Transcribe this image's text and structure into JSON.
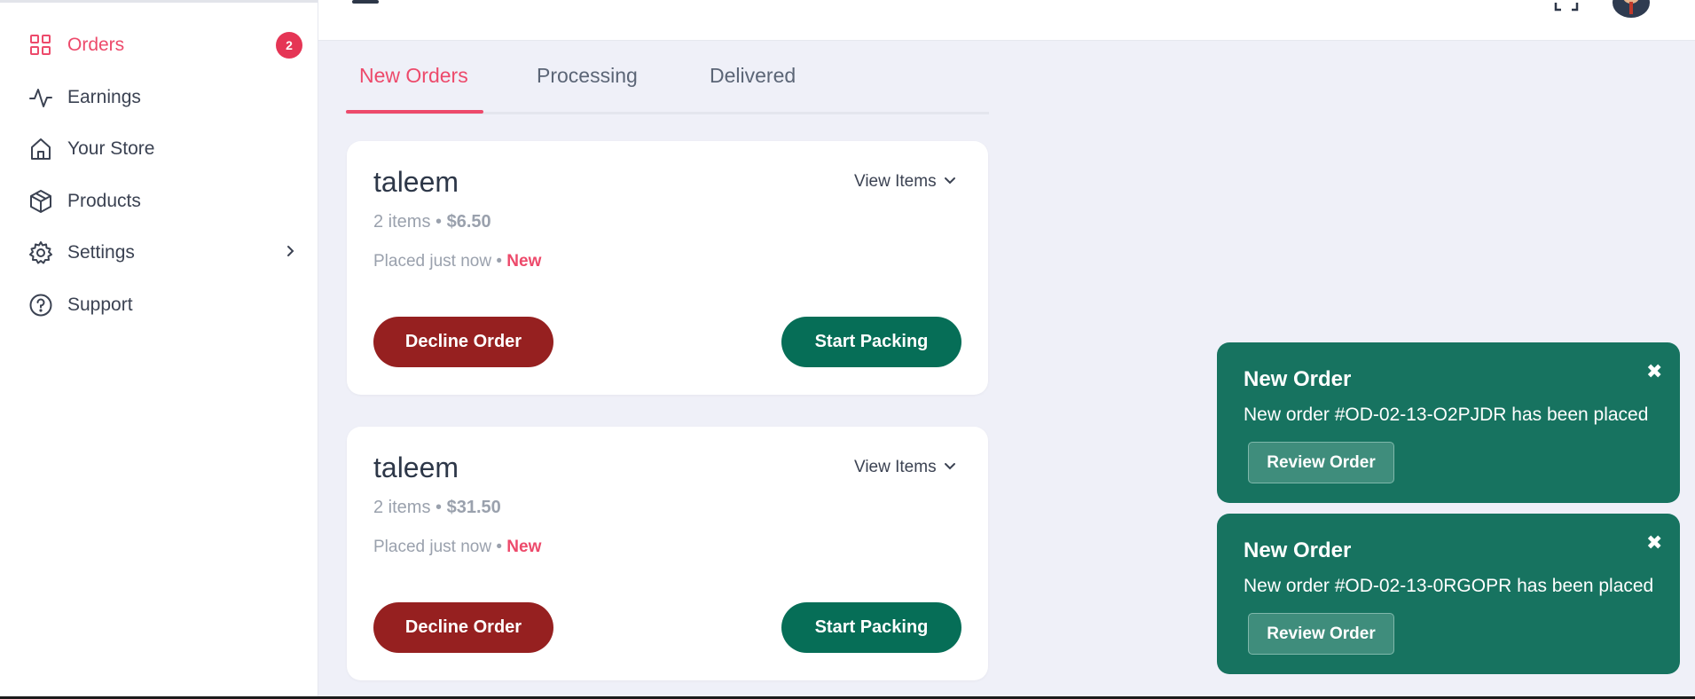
{
  "sidebar": {
    "items": [
      {
        "label": "Orders",
        "icon": "grid-icon",
        "badge": "2",
        "active": true
      },
      {
        "label": "Earnings",
        "icon": "activity-icon"
      },
      {
        "label": "Your Store",
        "icon": "home-icon"
      },
      {
        "label": "Products",
        "icon": "box-icon"
      },
      {
        "label": "Settings",
        "icon": "gear-icon",
        "chevron": true
      },
      {
        "label": "Support",
        "icon": "help-circle-icon"
      }
    ]
  },
  "tabs": [
    "New Orders",
    "Processing",
    "Delivered"
  ],
  "active_tab": "New Orders",
  "orders": [
    {
      "customer": "taleem",
      "items": "2 items",
      "separator": " • ",
      "price": "$6.50",
      "placed": "Placed just now",
      "status": "New",
      "view_items": "View Items",
      "decline_label": "Decline Order",
      "pack_label": "Start Packing"
    },
    {
      "customer": "taleem",
      "items": "2 items",
      "separator": " • ",
      "price": "$31.50",
      "placed": "Placed just now",
      "status": "New",
      "view_items": "View Items",
      "decline_label": "Decline Order",
      "pack_label": "Start Packing"
    }
  ],
  "toasts": [
    {
      "title": "New Order",
      "message": "New order #OD-02-13-O2PJDR has been placed",
      "button": "Review Order",
      "close": "✖"
    },
    {
      "title": "New Order",
      "message": "New order #OD-02-13-0RGOPR has been placed",
      "button": "Review Order",
      "close": "✖"
    }
  ],
  "colors": {
    "accent": "#ed4a6b",
    "decline": "#962020",
    "pack": "#066e57",
    "toast_bg": "#177360",
    "background": "#eff0f8"
  }
}
